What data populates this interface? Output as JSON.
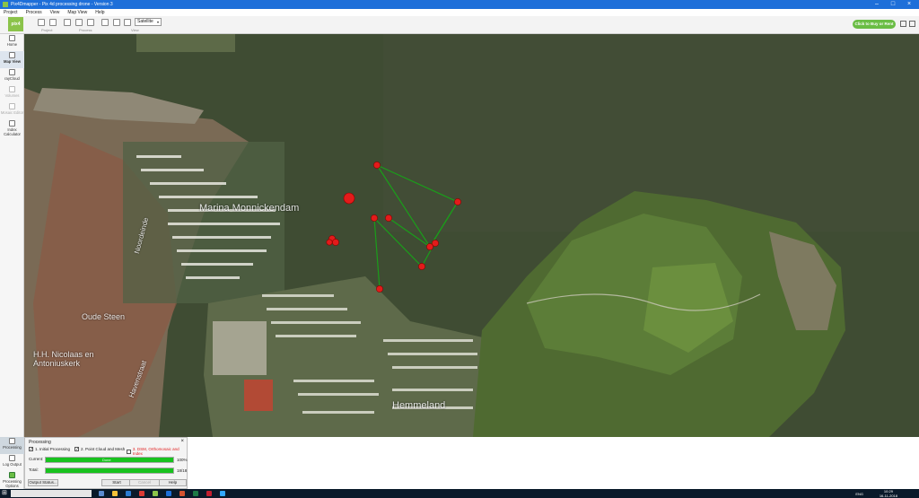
{
  "window": {
    "title": "Pix4Dmapper - Pix 4d processing drone - Version 3"
  },
  "menu": [
    "Project",
    "Process",
    "View",
    "Map View",
    "Help"
  ],
  "toolbar": {
    "logo": "pix4",
    "groups": [
      "Project",
      "Process",
      "View"
    ],
    "basemap_selected": "Satellite",
    "buy_label": "Click to Buy or Rent"
  },
  "sidebar": {
    "items": [
      {
        "label": "Home",
        "icon": "home-icon"
      },
      {
        "label": "Map View",
        "icon": "map-icon"
      },
      {
        "label": "rayCloud",
        "icon": "raycloud-icon"
      },
      {
        "label": "Volumes",
        "icon": "volumes-icon"
      },
      {
        "label": "Mosaic Editor",
        "icon": "mosaic-icon"
      },
      {
        "label": "Index Calculator",
        "icon": "index-icon"
      }
    ],
    "bottom": [
      {
        "label": "Processing",
        "icon": "processing-icon"
      },
      {
        "label": "Log Output",
        "icon": "log-icon"
      },
      {
        "label": "Processing Options",
        "icon": "options-icon"
      }
    ]
  },
  "map": {
    "labels": [
      "Marina Monnickendam",
      "Oude Steen",
      "H.H. Nicolaas en Antoniuskerk",
      "Hemmeland",
      "Noordeinde",
      "Havenstraat"
    ],
    "accent": "#e31b1b",
    "flight_color": "#1a9e1a"
  },
  "processing": {
    "title": "Processing",
    "steps": [
      {
        "label": "1. Initial Processing",
        "checked": true
      },
      {
        "label": "2. Point Cloud and Mesh",
        "checked": true
      },
      {
        "label": "3. DSM, Orthomosaic and Index",
        "checked": false
      }
    ],
    "current_label": "Current:",
    "current_text": "Done",
    "current_value": "100%",
    "current_progress": 1.0,
    "total_label": "Total:",
    "total_value": "18/18",
    "total_progress": 1.0,
    "buttons": {
      "output_status": "Output Status...",
      "start": "Start",
      "cancel": "Cancel",
      "help": "Help"
    }
  },
  "taskbar": {
    "time": "10:29",
    "date": "16-11-2018",
    "lang": "ENG"
  }
}
